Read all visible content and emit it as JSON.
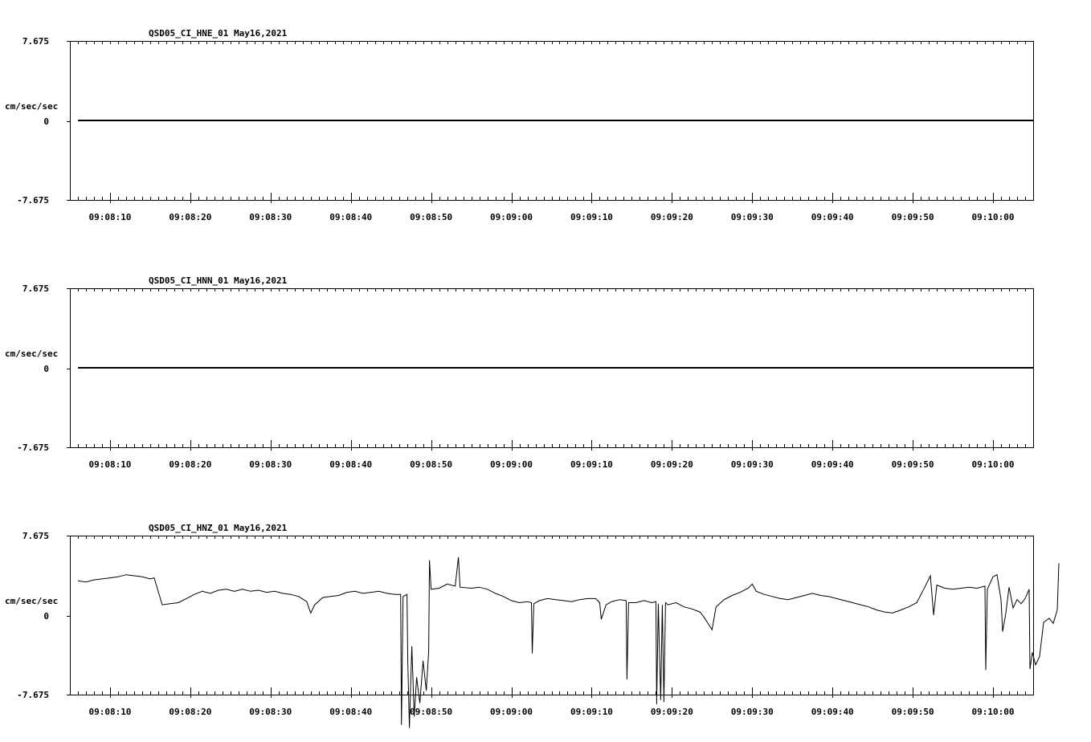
{
  "chart_data": [
    {
      "type": "line",
      "title": "QSD05_CI_HNE_01  May16,2021",
      "ylabel": "cm/sec/sec",
      "ylim": [
        -7.675,
        7.675
      ],
      "yticks": [
        "7.675",
        "0",
        "-7.675"
      ],
      "xticks": [
        "09:08:10",
        "09:08:20",
        "09:08:30",
        "09:08:40",
        "09:08:50",
        "09:09:00",
        "09:09:10",
        "09:09:20",
        "09:09:30",
        "09:09:40",
        "09:09:50",
        "09:10:00"
      ],
      "xlim_seconds_after_09_08_00": [
        5,
        125
      ],
      "series": [
        {
          "values": [
            [
              6,
              0.0
            ],
            [
              125,
              0.0
            ]
          ]
        }
      ]
    },
    {
      "type": "line",
      "title": "QSD05_CI_HNN_01  May16,2021",
      "ylabel": "cm/sec/sec",
      "ylim": [
        -7.675,
        7.675
      ],
      "yticks": [
        "7.675",
        "0",
        "-7.675"
      ],
      "xticks": [
        "09:08:10",
        "09:08:20",
        "09:08:30",
        "09:08:40",
        "09:08:50",
        "09:09:00",
        "09:09:10",
        "09:09:20",
        "09:09:30",
        "09:09:40",
        "09:09:50",
        "09:10:00"
      ],
      "xlim_seconds_after_09_08_00": [
        5,
        125
      ],
      "series": [
        {
          "values": [
            [
              6,
              0.0
            ],
            [
              125,
              0.0
            ]
          ]
        }
      ]
    },
    {
      "type": "line",
      "title": "QSD05_CI_HNZ_01  May16,2021",
      "ylabel": "cm/sec/sec",
      "ylim": [
        -7.675,
        7.675
      ],
      "yticks": [
        "7.675",
        "0",
        "-7.675"
      ],
      "xticks": [
        "09:08:10",
        "09:08:20",
        "09:08:30",
        "09:08:40",
        "09:08:50",
        "09:09:00",
        "09:09:10",
        "09:09:20",
        "09:09:30",
        "09:09:40",
        "09:09:50",
        "09:10:00"
      ],
      "xlim_seconds_after_09_08_00": [
        5,
        125
      ],
      "series": [
        {
          "values": [
            [
              6.0,
              3.3
            ],
            [
              7.0,
              3.2
            ],
            [
              8.0,
              3.4
            ],
            [
              9.0,
              3.5
            ],
            [
              10.0,
              3.6
            ],
            [
              11.0,
              3.7
            ],
            [
              12.0,
              3.9
            ],
            [
              13.0,
              3.8
            ],
            [
              14.0,
              3.7
            ],
            [
              15.0,
              3.5
            ],
            [
              15.5,
              3.6
            ],
            [
              16.5,
              1.0
            ],
            [
              17.5,
              1.1
            ],
            [
              18.5,
              1.2
            ],
            [
              19.5,
              1.6
            ],
            [
              20.5,
              2.0
            ],
            [
              21.5,
              2.3
            ],
            [
              22.5,
              2.1
            ],
            [
              23.5,
              2.4
            ],
            [
              24.5,
              2.5
            ],
            [
              25.5,
              2.3
            ],
            [
              26.5,
              2.5
            ],
            [
              27.5,
              2.3
            ],
            [
              28.5,
              2.4
            ],
            [
              29.5,
              2.2
            ],
            [
              30.5,
              2.3
            ],
            [
              31.5,
              2.1
            ],
            [
              32.5,
              2.0
            ],
            [
              33.5,
              1.8
            ],
            [
              34.5,
              1.3
            ],
            [
              35.0,
              0.2
            ],
            [
              35.5,
              1.0
            ],
            [
              36.5,
              1.7
            ],
            [
              37.5,
              1.8
            ],
            [
              38.5,
              1.9
            ],
            [
              39.5,
              2.2
            ],
            [
              40.5,
              2.3
            ],
            [
              41.5,
              2.1
            ],
            [
              42.5,
              2.2
            ],
            [
              43.5,
              2.3
            ],
            [
              44.5,
              2.1
            ],
            [
              45.5,
              2.0
            ],
            [
              46.2,
              2.0
            ],
            [
              46.3,
              -10.6
            ],
            [
              46.5,
              1.8
            ],
            [
              47.0,
              2.0
            ],
            [
              47.1,
              -4.5
            ],
            [
              47.3,
              -10.9
            ],
            [
              47.6,
              -3.0
            ],
            [
              47.9,
              -9.8
            ],
            [
              48.2,
              -6.0
            ],
            [
              48.6,
              -8.5
            ],
            [
              49.0,
              -4.4
            ],
            [
              49.4,
              -7.3
            ],
            [
              49.7,
              -3.5
            ],
            [
              49.8,
              5.3
            ],
            [
              50.0,
              2.5
            ],
            [
              51.0,
              2.6
            ],
            [
              52.0,
              3.0
            ],
            [
              53.0,
              2.8
            ],
            [
              53.4,
              5.6
            ],
            [
              53.6,
              2.7
            ],
            [
              55.0,
              2.6
            ],
            [
              56.0,
              2.7
            ],
            [
              57.0,
              2.5
            ],
            [
              58.0,
              2.1
            ],
            [
              59.0,
              1.8
            ],
            [
              60.0,
              1.4
            ],
            [
              61.0,
              1.2
            ],
            [
              62.0,
              1.3
            ],
            [
              62.5,
              1.2
            ],
            [
              62.6,
              -3.7
            ],
            [
              62.8,
              1.1
            ],
            [
              63.5,
              1.4
            ],
            [
              64.5,
              1.6
            ],
            [
              65.5,
              1.5
            ],
            [
              66.5,
              1.4
            ],
            [
              67.5,
              1.3
            ],
            [
              68.5,
              1.5
            ],
            [
              69.5,
              1.6
            ],
            [
              70.5,
              1.6
            ],
            [
              71.0,
              1.2
            ],
            [
              71.2,
              -0.4
            ],
            [
              71.8,
              1.0
            ],
            [
              72.5,
              1.3
            ],
            [
              73.5,
              1.5
            ],
            [
              74.3,
              1.4
            ],
            [
              74.4,
              -6.2
            ],
            [
              74.6,
              1.2
            ],
            [
              75.5,
              1.2
            ],
            [
              76.5,
              1.4
            ],
            [
              77.5,
              1.2
            ],
            [
              78.0,
              1.3
            ],
            [
              78.1,
              -8.6
            ],
            [
              78.3,
              1.1
            ],
            [
              78.6,
              -8.2
            ],
            [
              78.8,
              1.0
            ],
            [
              79.0,
              -8.4
            ],
            [
              79.2,
              1.2
            ],
            [
              79.5,
              1.0
            ],
            [
              80.5,
              1.2
            ],
            [
              81.5,
              0.8
            ],
            [
              82.5,
              0.6
            ],
            [
              83.5,
              0.3
            ],
            [
              84.0,
              -0.2
            ],
            [
              85.0,
              -1.4
            ],
            [
              85.5,
              0.8
            ],
            [
              86.5,
              1.5
            ],
            [
              87.5,
              1.9
            ],
            [
              88.5,
              2.2
            ],
            [
              89.5,
              2.6
            ],
            [
              90.0,
              3.0
            ],
            [
              90.5,
              2.3
            ],
            [
              91.5,
              2.0
            ],
            [
              92.5,
              1.8
            ],
            [
              93.5,
              1.6
            ],
            [
              94.5,
              1.5
            ],
            [
              95.5,
              1.7
            ],
            [
              96.5,
              1.9
            ],
            [
              97.5,
              2.1
            ],
            [
              98.5,
              1.9
            ],
            [
              99.5,
              1.8
            ],
            [
              100.5,
              1.6
            ],
            [
              101.5,
              1.4
            ],
            [
              102.5,
              1.2
            ],
            [
              103.5,
              1.0
            ],
            [
              104.5,
              0.8
            ],
            [
              105.5,
              0.5
            ],
            [
              106.5,
              0.3
            ],
            [
              107.5,
              0.2
            ],
            [
              108.5,
              0.5
            ],
            [
              109.5,
              0.8
            ],
            [
              110.5,
              1.2
            ],
            [
              111.5,
              2.7
            ],
            [
              112.2,
              3.8
            ],
            [
              112.6,
              0.0
            ],
            [
              113.0,
              2.9
            ],
            [
              114.0,
              2.6
            ],
            [
              115.0,
              2.5
            ],
            [
              116.0,
              2.6
            ],
            [
              117.0,
              2.7
            ],
            [
              118.0,
              2.6
            ],
            [
              119.0,
              2.8
            ],
            [
              119.1,
              -5.3
            ],
            [
              119.3,
              2.5
            ],
            [
              120.0,
              3.7
            ],
            [
              120.5,
              3.9
            ],
            [
              121.0,
              1.5
            ],
            [
              121.2,
              -1.6
            ],
            [
              121.6,
              0.2
            ],
            [
              122.0,
              2.7
            ],
            [
              122.5,
              0.7
            ],
            [
              123.0,
              1.5
            ],
            [
              123.5,
              1.1
            ],
            [
              124.0,
              1.6
            ],
            [
              124.5,
              2.5
            ],
            [
              124.6,
              -5.2
            ],
            [
              124.9,
              -3.6
            ],
            [
              125.3,
              -4.8
            ],
            [
              125.8,
              -4.0
            ],
            [
              126.3,
              -0.7
            ],
            [
              127.0,
              -0.3
            ],
            [
              127.5,
              -0.8
            ],
            [
              128.0,
              0.5
            ],
            [
              128.2,
              5.0
            ]
          ]
        }
      ]
    }
  ]
}
